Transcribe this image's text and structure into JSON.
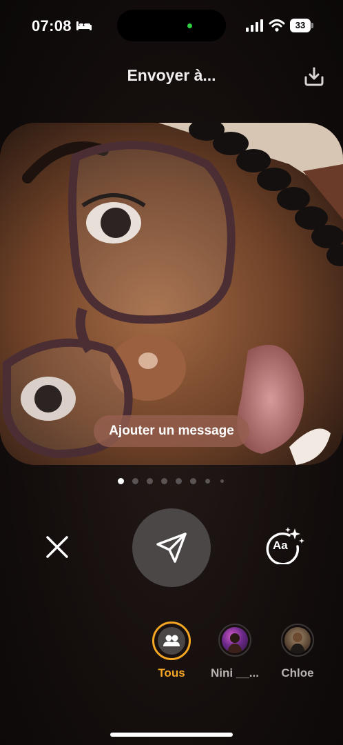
{
  "status_bar": {
    "time": "07:08",
    "battery": "33",
    "icons": [
      "bed-icon",
      "signal-icon",
      "wifi-icon",
      "battery-icon"
    ]
  },
  "header": {
    "title": "Envoyer à...",
    "download_icon": "download-icon"
  },
  "photo": {
    "add_message_label": "Ajouter un message"
  },
  "pagination": {
    "total": 8,
    "active": 1
  },
  "controls": {
    "close_icon": "close-icon",
    "send_icon": "paper-plane-icon",
    "text_style_label": "Aa"
  },
  "recipients": [
    {
      "name": "Tous",
      "selected": true,
      "icon": "group-icon"
    },
    {
      "name": "Nini __...",
      "selected": false
    },
    {
      "name": "Chloe",
      "selected": false
    }
  ],
  "colors": {
    "accent": "#f5a623",
    "send_button": "#4b4746",
    "message_pill": "#965f50"
  }
}
